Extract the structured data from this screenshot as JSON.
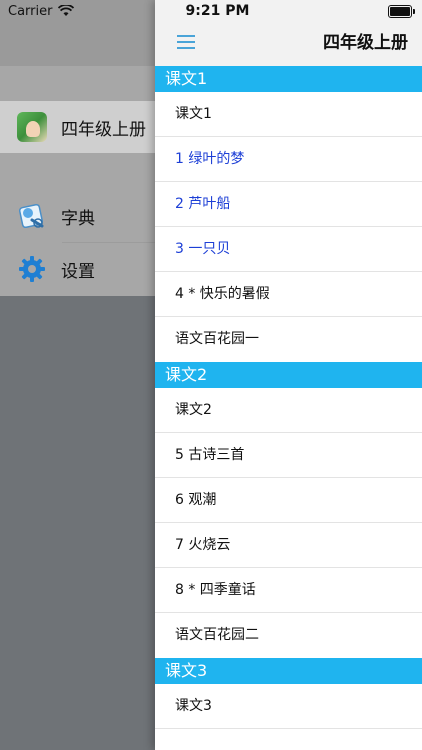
{
  "status": {
    "carrier": "Carrier",
    "time": "9:21 PM"
  },
  "sidebar": {
    "items": [
      {
        "label": "四年级上册",
        "icon": "book-cover-thumbnail"
      },
      {
        "label": "字典",
        "icon": "dictionary-icon"
      },
      {
        "label": "设置",
        "icon": "gear-icon"
      }
    ]
  },
  "header": {
    "title": "四年级上册",
    "menu_icon": "menu-icon"
  },
  "sections": [
    {
      "title": "课文1",
      "rows": [
        {
          "label": "课文1",
          "highlight": false
        },
        {
          "label": "1 绿叶的梦",
          "highlight": true
        },
        {
          "label": "2 芦叶船",
          "highlight": true
        },
        {
          "label": "3 一只贝",
          "highlight": true
        },
        {
          "label": "4 * 快乐的暑假",
          "highlight": false
        },
        {
          "label": "语文百花园一",
          "highlight": false
        }
      ]
    },
    {
      "title": "课文2",
      "rows": [
        {
          "label": "课文2",
          "highlight": false
        },
        {
          "label": "5 古诗三首",
          "highlight": false
        },
        {
          "label": "6 观潮",
          "highlight": false
        },
        {
          "label": "7 火烧云",
          "highlight": false
        },
        {
          "label": "8 * 四季童话",
          "highlight": false
        },
        {
          "label": "语文百花园二",
          "highlight": false
        }
      ]
    },
    {
      "title": "课文3",
      "rows": [
        {
          "label": "课文3",
          "highlight": false
        }
      ]
    }
  ],
  "colors": {
    "section_header": "#1fb4ef",
    "highlight_text": "#1d3fd6",
    "menu_icon": "#4aa4d8"
  }
}
